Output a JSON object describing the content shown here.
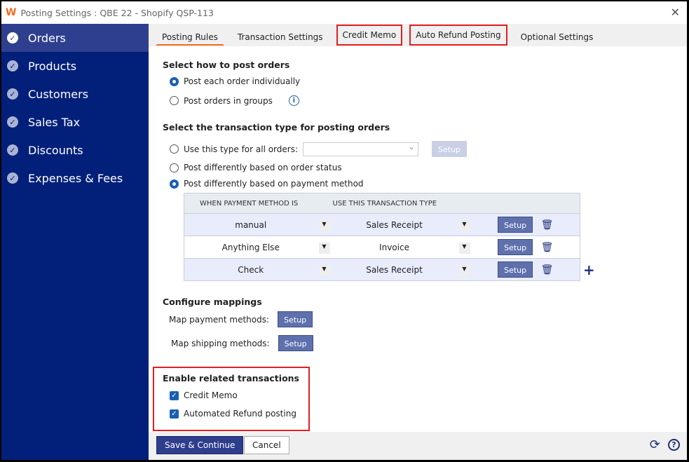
{
  "window": {
    "title": "Posting Settings : QBE 22 - Shopify QSP-113",
    "close": "✕"
  },
  "sidebar": {
    "items": [
      {
        "label": "Orders"
      },
      {
        "label": "Products"
      },
      {
        "label": "Customers"
      },
      {
        "label": "Sales Tax"
      },
      {
        "label": "Discounts"
      },
      {
        "label": "Expenses & Fees"
      }
    ]
  },
  "tabs": [
    "Posting Rules",
    "Transaction Settings",
    "Credit Memo",
    "Auto Refund Posting",
    "Optional Settings"
  ],
  "post": {
    "heading": "Select how to post orders",
    "opt1": "Post each order individually",
    "opt2": "Post orders in groups",
    "selected": "Post each order individually"
  },
  "ttype": {
    "heading": "Select the transaction type for posting orders",
    "opt1": "Use this type for all orders:",
    "select_value": "",
    "setup": "Setup",
    "opt2": "Post differently based on order status",
    "opt3": "Post differently based on payment method",
    "selected": "Post differently based on payment method"
  },
  "table": {
    "headers": [
      "WHEN PAYMENT METHOD IS",
      "USE THIS TRANSACTION TYPE"
    ],
    "rows": [
      {
        "method": "manual",
        "type": "Sales Receipt",
        "setup": "Setup"
      },
      {
        "method": "Anything Else",
        "type": "Invoice",
        "setup": "Setup"
      },
      {
        "method": "Check",
        "type": "Sales Receipt",
        "setup": "Setup"
      }
    ]
  },
  "mappings": {
    "heading": "Configure mappings",
    "payment": "Map payment methods:",
    "shipping": "Map shipping methods:",
    "setup": "Setup"
  },
  "related": {
    "heading": "Enable related transactions",
    "cb1": "Credit Memo",
    "cb2": "Automated Refund posting",
    "cb1_checked": true,
    "cb2_checked": true
  },
  "footer": {
    "save": "Save & Continue",
    "cancel": "Cancel"
  }
}
